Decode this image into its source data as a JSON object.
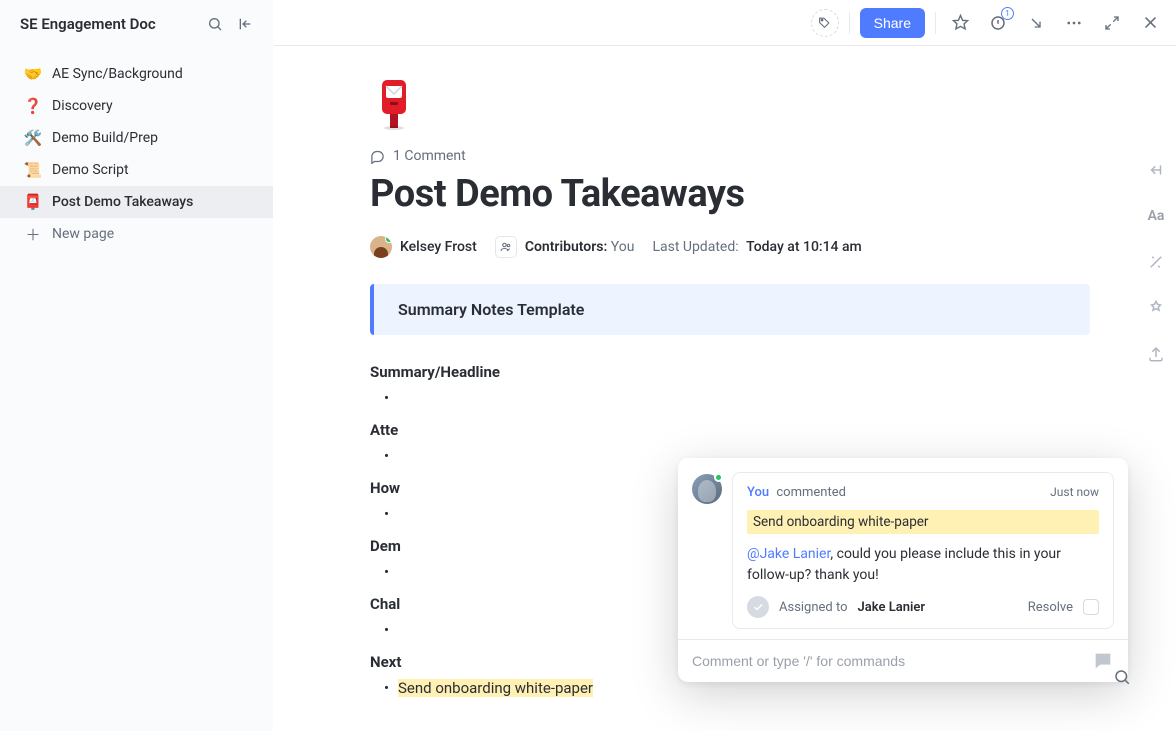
{
  "sidebar": {
    "title": "SE Engagement Doc",
    "items": [
      {
        "emoji": "🤝",
        "label": "AE Sync/Background"
      },
      {
        "emoji": "❓",
        "label": "Discovery"
      },
      {
        "emoji": "🛠️",
        "label": "Demo Build/Prep"
      },
      {
        "emoji": "📜",
        "label": "Demo Script"
      },
      {
        "emoji": "📮",
        "label": "Post Demo Takeaways"
      }
    ],
    "new_page_label": "New page"
  },
  "topbar": {
    "share_label": "Share",
    "notification_count": "1"
  },
  "doc": {
    "comment_count_label": "1 Comment",
    "title": "Post Demo Takeaways",
    "author": "Kelsey Frost",
    "contributors_label": "Contributors:",
    "contributors_value": "You",
    "last_updated_label": "Last Updated:",
    "last_updated_value": "Today at 10:14 am",
    "template_banner": "Summary Notes Template",
    "sections": {
      "summary": "Summary/Headline",
      "attendees_prefix": "Atte",
      "how_prefix": "How",
      "demo_prefix": "Dem",
      "challenges_prefix": "Chal",
      "next": "Next",
      "next_item": "Send onboarding white-paper"
    }
  },
  "comment_popup": {
    "you_label": "You",
    "commented_label": "commented",
    "timestamp": "Just now",
    "quoted_text": "Send onboarding white-paper",
    "mention": "@Jake Lanier",
    "body_rest": ", could you please include this in your follow-up? thank you!",
    "assigned_to_label": "Assigned to",
    "assignee": "Jake Lanier",
    "resolve_label": "Resolve",
    "input_placeholder": "Comment or type '/' for commands"
  },
  "right_rail": {
    "aa_label": "Aa"
  }
}
